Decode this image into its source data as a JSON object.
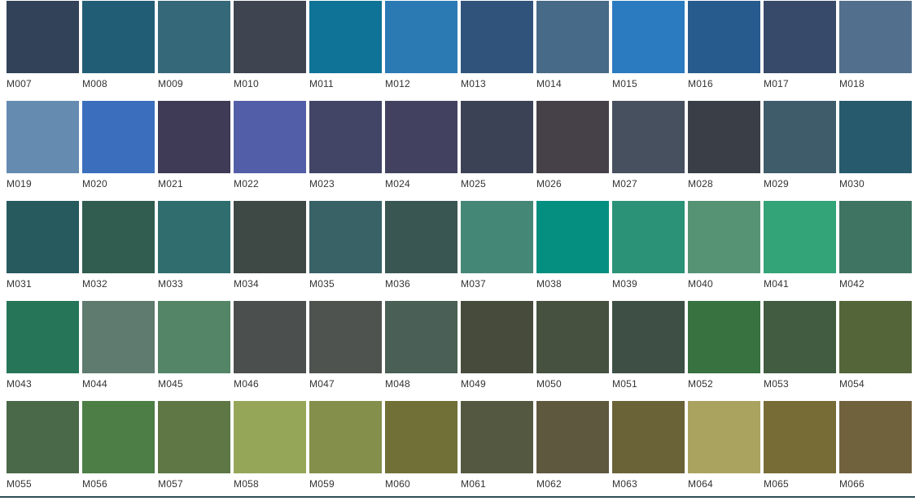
{
  "swatches": [
    {
      "code": "M007",
      "color": "#324258"
    },
    {
      "code": "M008",
      "color": "#225d76"
    },
    {
      "code": "M009",
      "color": "#356879"
    },
    {
      "code": "M010",
      "color": "#3e4551"
    },
    {
      "code": "M011",
      "color": "#0e7396"
    },
    {
      "code": "M012",
      "color": "#2c7ab4"
    },
    {
      "code": "M013",
      "color": "#30537c"
    },
    {
      "code": "M014",
      "color": "#466a87"
    },
    {
      "code": "M015",
      "color": "#2b7bc0"
    },
    {
      "code": "M016",
      "color": "#285b8d"
    },
    {
      "code": "M017",
      "color": "#384a6a"
    },
    {
      "code": "M018",
      "color": "#526f8d"
    },
    {
      "code": "M019",
      "color": "#658bb1"
    },
    {
      "code": "M020",
      "color": "#3b6fbd"
    },
    {
      "code": "M021",
      "color": "#3f3a55"
    },
    {
      "code": "M022",
      "color": "#535ea8"
    },
    {
      "code": "M023",
      "color": "#424566"
    },
    {
      "code": "M024",
      "color": "#424260"
    },
    {
      "code": "M025",
      "color": "#3c4255"
    },
    {
      "code": "M026",
      "color": "#464149"
    },
    {
      "code": "M027",
      "color": "#47505e"
    },
    {
      "code": "M028",
      "color": "#3a3f47"
    },
    {
      "code": "M029",
      "color": "#3f5c6b"
    },
    {
      "code": "M030",
      "color": "#265a6c"
    },
    {
      "code": "M031",
      "color": "#275a5f"
    },
    {
      "code": "M032",
      "color": "#305d50"
    },
    {
      "code": "M033",
      "color": "#2f6d6e"
    },
    {
      "code": "M034",
      "color": "#3e4945"
    },
    {
      "code": "M035",
      "color": "#386266"
    },
    {
      "code": "M036",
      "color": "#3a5653"
    },
    {
      "code": "M037",
      "color": "#458777"
    },
    {
      "code": "M038",
      "color": "#058f81"
    },
    {
      "code": "M039",
      "color": "#2b9277"
    },
    {
      "code": "M040",
      "color": "#569274"
    },
    {
      "code": "M041",
      "color": "#33a378"
    },
    {
      "code": "M042",
      "color": "#3f7462"
    },
    {
      "code": "M043",
      "color": "#277559"
    },
    {
      "code": "M044",
      "color": "#5f7b70"
    },
    {
      "code": "M045",
      "color": "#538566"
    },
    {
      "code": "M046",
      "color": "#4b4f4e"
    },
    {
      "code": "M047",
      "color": "#4f5350"
    },
    {
      "code": "M048",
      "color": "#4a5f55"
    },
    {
      "code": "M049",
      "color": "#464b3b"
    },
    {
      "code": "M050",
      "color": "#465140"
    },
    {
      "code": "M051",
      "color": "#3e5046"
    },
    {
      "code": "M052",
      "color": "#377240"
    },
    {
      "code": "M053",
      "color": "#425c41"
    },
    {
      "code": "M054",
      "color": "#546539"
    },
    {
      "code": "M055",
      "color": "#4a6949"
    },
    {
      "code": "M056",
      "color": "#4c7e45"
    },
    {
      "code": "M057",
      "color": "#5e7745"
    },
    {
      "code": "M058",
      "color": "#96a659"
    },
    {
      "code": "M059",
      "color": "#838f4b"
    },
    {
      "code": "M060",
      "color": "#717036"
    },
    {
      "code": "M061",
      "color": "#555840"
    },
    {
      "code": "M062",
      "color": "#5e583e"
    },
    {
      "code": "M063",
      "color": "#6a6338"
    },
    {
      "code": "M064",
      "color": "#a9a35f"
    },
    {
      "code": "M065",
      "color": "#776c36"
    },
    {
      "code": "M066",
      "color": "#71623e"
    }
  ]
}
